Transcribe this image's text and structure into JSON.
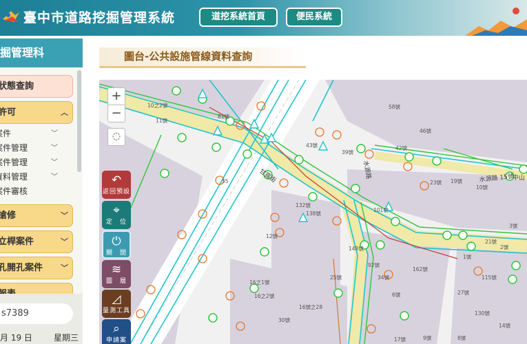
{
  "header": {
    "title": "臺中市道路挖掘管理系統",
    "buttons": {
      "home": "道挖系統首頁",
      "service": "便民系統"
    }
  },
  "sidebar": {
    "title": "掘管理科",
    "menu": {
      "status": "狀態查詢",
      "permit": "許可",
      "permit_items": [
        "案件",
        "案件管理",
        "案件管理",
        "資料管理",
        "案件審核"
      ],
      "repair": "搶修",
      "pole": "立桿案件",
      "hole": "孔開孔案件",
      "report": "報表"
    },
    "user_id": "s7389",
    "date": "月 19 日",
    "weekday": "星期三"
  },
  "main": {
    "page_title": "圖台-公共設施管線資料查詢"
  },
  "map": {
    "controls": {
      "zoom_in": "+",
      "zoom_out": "−",
      "locate": "◌"
    },
    "tools": {
      "back": "返回預設",
      "locate": "定　位",
      "close": "關　閉",
      "layers": "圖　層",
      "measure": "量測工具",
      "case": "申請案"
    },
    "labels": {
      "road_ganlu": "甘露街",
      "road_shuiyuan": "水源路",
      "road_shuiyuan_2": "水源路 15號",
      "road_zhongshan": "中山",
      "addr_81": "81號",
      "addr_43": "43號",
      "addr_42": "42號",
      "addr_46": "46號",
      "addr_58": "58號",
      "addr_39": "39號",
      "addr_23": "23號",
      "addr_19": "19號",
      "addr_101": "101號",
      "addr_138": "138號",
      "addr_132": "132號",
      "addr_148": "148號",
      "addr_162": "162號",
      "addr_1": "1號",
      "addr_16zhi1": "16之1號",
      "addr_16zhi2": "16之2號",
      "addr_16zhi28": "16號之28",
      "addr_10zhi2": "10之2號",
      "addr_11": "11號",
      "addr_12": "12號",
      "addr_25": "25號",
      "addr_30": "30號",
      "addr_55": "55",
      "addr_21": "21號",
      "addr_2": "2號",
      "addr_3": "3號",
      "addr_92": "92號",
      "addr_34": "34號",
      "addr_6": "6號",
      "addr_17": "17號",
      "addr_27": "27號",
      "addr_130": "130號",
      "addr_115": "115號",
      "addr_9": "9號",
      "addr_10": "10號",
      "addr_8": "8號",
      "addr_14": "14號"
    }
  },
  "colors": {
    "header_primary": "#1e7f96",
    "header_button": "#1d8a83",
    "sidebar_title": "#3aa1b4",
    "menu_button": "#f8d98a",
    "pipe_cyan": "#20c4cc",
    "pipe_green": "#2fc63a",
    "manhole_orange": "#e5772a",
    "road_yellow": "#f0e9a8"
  },
  "icons": {
    "logo": "city-logo-icon",
    "back": "back-arrow-icon",
    "locate": "location-pin-icon",
    "close": "power-icon",
    "layers": "layers-icon",
    "measure": "ruler-icon",
    "case": "case-search-icon"
  }
}
